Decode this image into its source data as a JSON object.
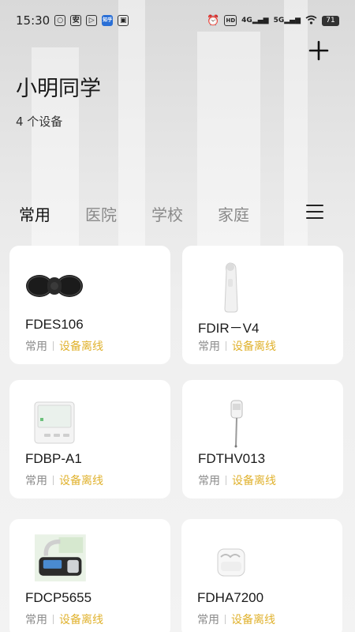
{
  "status_bar": {
    "time": "15:30",
    "left_icons": [
      "message-icon",
      "app-icon",
      "video-icon",
      "zhihu-icon",
      "gallery-icon"
    ],
    "zhihu_label": "知乎",
    "right_icons": [
      "alarm-icon",
      "hd-icon",
      "signal-4g-icon",
      "signal-5g-icon",
      "wifi-icon"
    ],
    "hd_label": "HD",
    "net1": "4G",
    "net2": "5G",
    "battery": "71"
  },
  "header": {
    "title": "小明同学",
    "device_count": "4 个设备",
    "add_icon": "plus-icon"
  },
  "tabs": [
    {
      "label": "常用",
      "active": true
    },
    {
      "label": "医院",
      "active": false
    },
    {
      "label": "学校",
      "active": false
    },
    {
      "label": "家庭",
      "active": false
    }
  ],
  "devices": [
    {
      "name": "FDES106",
      "scene": "常用",
      "status": "设备离线",
      "image": "tens-massager"
    },
    {
      "name": "FDIR－V4",
      "scene": "常用",
      "status": "设备离线",
      "image": "ear-thermometer"
    },
    {
      "name": "FDBP-A1",
      "scene": "常用",
      "status": "设备离线",
      "image": "blood-pressure-monitor"
    },
    {
      "name": "FDTHV013",
      "scene": "常用",
      "status": "设备离线",
      "image": "digital-thermometer"
    },
    {
      "name": "FDCP5655",
      "scene": "常用",
      "status": "设备离线",
      "image": "cpap-machine"
    },
    {
      "name": "FDHA7200",
      "scene": "常用",
      "status": "设备离线",
      "image": "hearing-aid"
    }
  ],
  "colors": {
    "offline": "#e0b22e",
    "tab_active": "#111111",
    "tab_inactive": "#8a8a8a"
  }
}
